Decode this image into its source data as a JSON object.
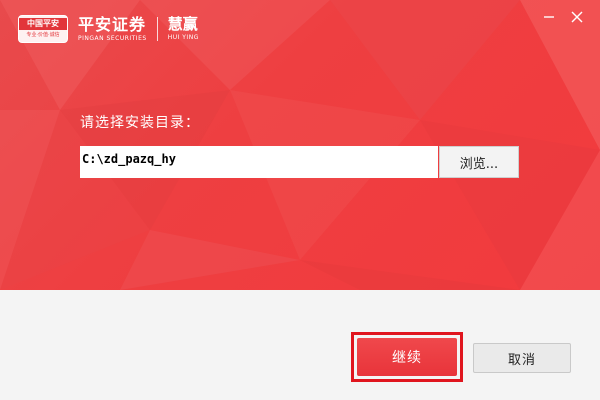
{
  "header": {
    "badge_top": "中国平安",
    "badge_bottom": "专业·价值·诚信",
    "brand_cn": "平安证券",
    "brand_en": "PINGAN SECURITIES",
    "sub_brand_cn": "慧赢",
    "sub_brand_en": "HUI YING"
  },
  "window_controls": {
    "minimize_icon": "minimize-icon",
    "close_icon": "close-icon"
  },
  "install": {
    "label": "请选择安装目录：",
    "path_value": "C:\\zd_pazq_hy",
    "browse_label": "浏览..."
  },
  "footer": {
    "continue_label": "继续",
    "cancel_label": "取消"
  },
  "colors": {
    "hero_red": "#ee3f41",
    "highlight_border": "#e0151e",
    "footer_bg": "#f4f4f4"
  }
}
